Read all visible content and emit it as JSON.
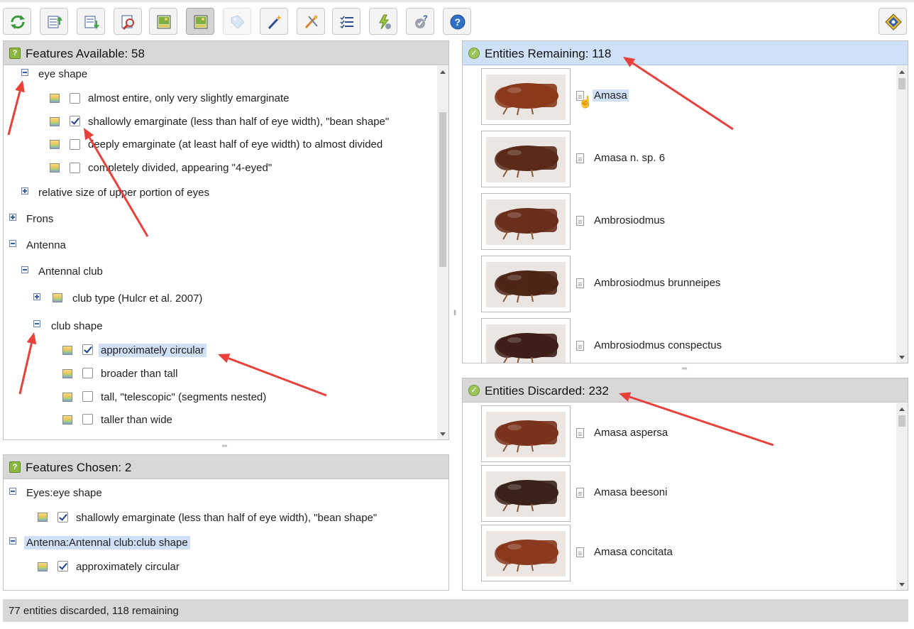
{
  "toolbar": {
    "buttons": [
      {
        "icon": "restart-icon",
        "tooltip": "Restart"
      },
      {
        "icon": "open-key-icon",
        "tooltip": "Open key"
      },
      {
        "icon": "save-icon",
        "tooltip": "Save"
      },
      {
        "icon": "search-features-icon",
        "tooltip": "Find"
      },
      {
        "icon": "image-view-icon",
        "tooltip": "Show images"
      },
      {
        "icon": "image-view-active-icon",
        "tooltip": "Show thumbnails",
        "active": true
      },
      {
        "icon": "tag-icon",
        "tooltip": "Tag",
        "disabled": true
      },
      {
        "icon": "magic-wand-icon",
        "tooltip": "Best"
      },
      {
        "icon": "prune-icon",
        "tooltip": "Prune"
      },
      {
        "icon": "ordered-list-icon",
        "tooltip": "Sort"
      },
      {
        "icon": "differences-icon",
        "tooltip": "Differences"
      },
      {
        "icon": "similarities-icon",
        "tooltip": "Similarities"
      },
      {
        "icon": "help-icon",
        "tooltip": "Help"
      },
      {
        "icon": "lucid-logo-icon",
        "tooltip": "About"
      }
    ]
  },
  "features_available": {
    "title": "Features Available: 58",
    "items": [
      {
        "label": "eye shape"
      },
      {
        "label": "almost entire, only very slightly emarginate",
        "checked": false
      },
      {
        "label": "shallowly emarginate (less than half of eye width), \"bean shape\"",
        "checked": true
      },
      {
        "label": "deeply emarginate (at least half of eye width) to almost divided",
        "checked": false
      },
      {
        "label": "completely divided, appearing \"4-eyed\"",
        "checked": false
      },
      {
        "label": "relative size of upper portion of eyes"
      },
      {
        "label": "Frons"
      },
      {
        "label": "Antenna"
      },
      {
        "label": "Antennal club"
      },
      {
        "label": "club type (Hulcr et al. 2007)"
      },
      {
        "label": "club shape"
      },
      {
        "label": "approximately circular",
        "checked": true
      },
      {
        "label": "broader than tall",
        "checked": false
      },
      {
        "label": "tall, \"telescopic\" (segments nested)",
        "checked": false
      },
      {
        "label": "taller than wide",
        "checked": false
      }
    ]
  },
  "features_chosen": {
    "title": "Features Chosen: 2",
    "items": [
      {
        "label": "Eyes:eye shape"
      },
      {
        "label": "shallowly emarginate (less than half of eye width), \"bean shape\"",
        "checked": true
      },
      {
        "label": "Antenna:Antennal club:club shape"
      },
      {
        "label": "approximately circular",
        "checked": true
      }
    ]
  },
  "entities_remaining": {
    "title": "Entities Remaining: 118",
    "items": [
      {
        "name": "Amasa",
        "color": "#8a3a1c"
      },
      {
        "name": "Amasa n. sp. 6",
        "color": "#5a2a18"
      },
      {
        "name": "Ambrosiodmus",
        "color": "#6a2e1c"
      },
      {
        "name": "Ambrosiodmus brunneipes",
        "color": "#4e2616"
      },
      {
        "name": "Ambrosiodmus conspectus",
        "color": "#3e1e16"
      }
    ]
  },
  "entities_discarded": {
    "title": "Entities Discarded: 232",
    "items": [
      {
        "name": "Amasa aspersa",
        "color": "#7a321c"
      },
      {
        "name": "Amasa beesoni",
        "color": "#3a221a"
      },
      {
        "name": "Amasa concitata",
        "color": "#8a3a1e"
      }
    ]
  },
  "status": {
    "text": "77 entities discarded, 118 remaining"
  },
  "colors": {
    "annotation_arrow": "#e8413c",
    "selection": "#cfe0f7",
    "header_blue": "#cfe1f6",
    "header_gray": "#d8d8d8"
  }
}
